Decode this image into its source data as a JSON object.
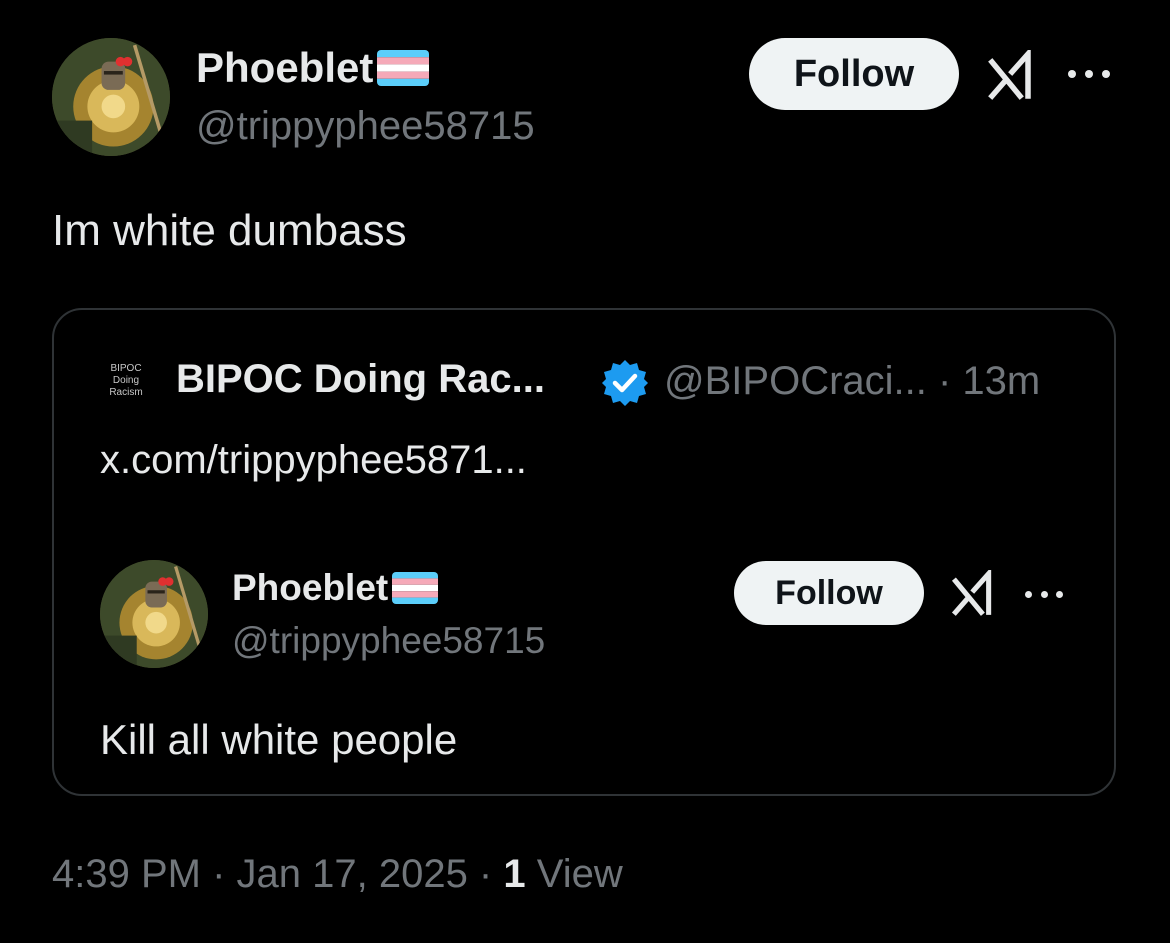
{
  "author": {
    "name": "Phoeblet",
    "handle": "@trippyphee58715",
    "flag_icon": "trans-flag-icon",
    "avatar_icon": "solaire-knight-avatar"
  },
  "header": {
    "follow_label": "Follow",
    "grok_icon": "grok-icon",
    "more_icon": "more-options-icon"
  },
  "tweet": {
    "text": "Im white dumbass"
  },
  "quote": {
    "logo_lines": [
      "BIPOC",
      "Doing",
      "Racism"
    ],
    "name": "BIPOC Doing Rac...",
    "verified_icon": "verified-badge-icon",
    "handle_time": "@BIPOCraci... · 13m",
    "link": "x.com/trippyphee5871...",
    "inner": {
      "name": "Phoeblet",
      "handle": "@trippyphee58715",
      "follow_label": "Follow",
      "text": "Kill all white people"
    }
  },
  "footer": {
    "time_date": "4:39 PM · Jan 17, 2025 · ",
    "views_count": "1",
    "views_label": " View"
  },
  "colors": {
    "background": "#000000",
    "text_primary": "#e7e9ea",
    "text_secondary": "#71767b",
    "border": "#2f3336",
    "verified_blue": "#1d9bf0",
    "follow_bg": "#eff3f4",
    "trans_blue": "#5BCEFA",
    "trans_pink": "#F5A9B8",
    "trans_white": "#FFFFFF"
  }
}
